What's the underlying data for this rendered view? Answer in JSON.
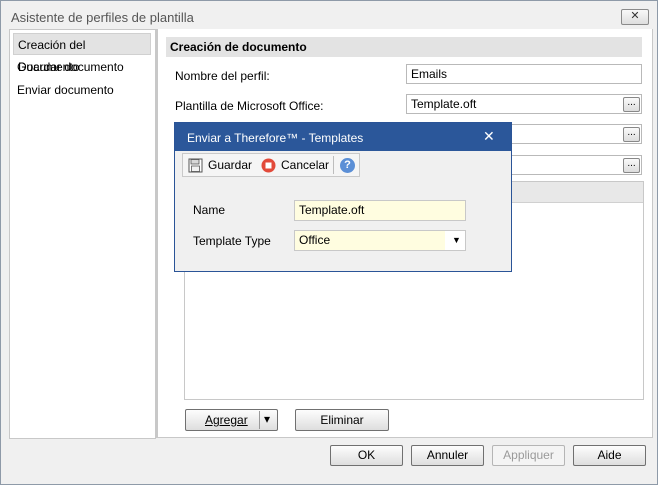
{
  "window": {
    "title": "Asistente de perfiles de plantilla",
    "close_label": "✕"
  },
  "sidebar": {
    "items": [
      {
        "label": "Creación del Documento"
      },
      {
        "label": "Guardar documento"
      },
      {
        "label": "Enviar documento"
      }
    ]
  },
  "main": {
    "section_title": "Creación de documento",
    "fields": [
      {
        "label": "Nombre del perfil:",
        "value": "Emails"
      },
      {
        "label": "Plantilla de Microsoft Office:",
        "value": "Template.oft"
      }
    ],
    "browse_label": "...",
    "add_label": "Agregar",
    "add_dropdown": "▾",
    "delete_label": "Eliminar"
  },
  "footer": {
    "ok_label": "OK",
    "cancel_label": "Annuler",
    "apply_label": "Appliquer",
    "help_label": "Aide"
  },
  "dialog": {
    "title": "Enviar a Therefore™ - Templates",
    "close_label": "✕",
    "toolbar": {
      "save_label": "Guardar",
      "cancel_label": "Cancelar",
      "help_label": "?"
    },
    "name_label": "Name",
    "name_value": "Template.oft",
    "type_label": "Template Type",
    "type_value": "Office",
    "type_arrow": "▼"
  }
}
